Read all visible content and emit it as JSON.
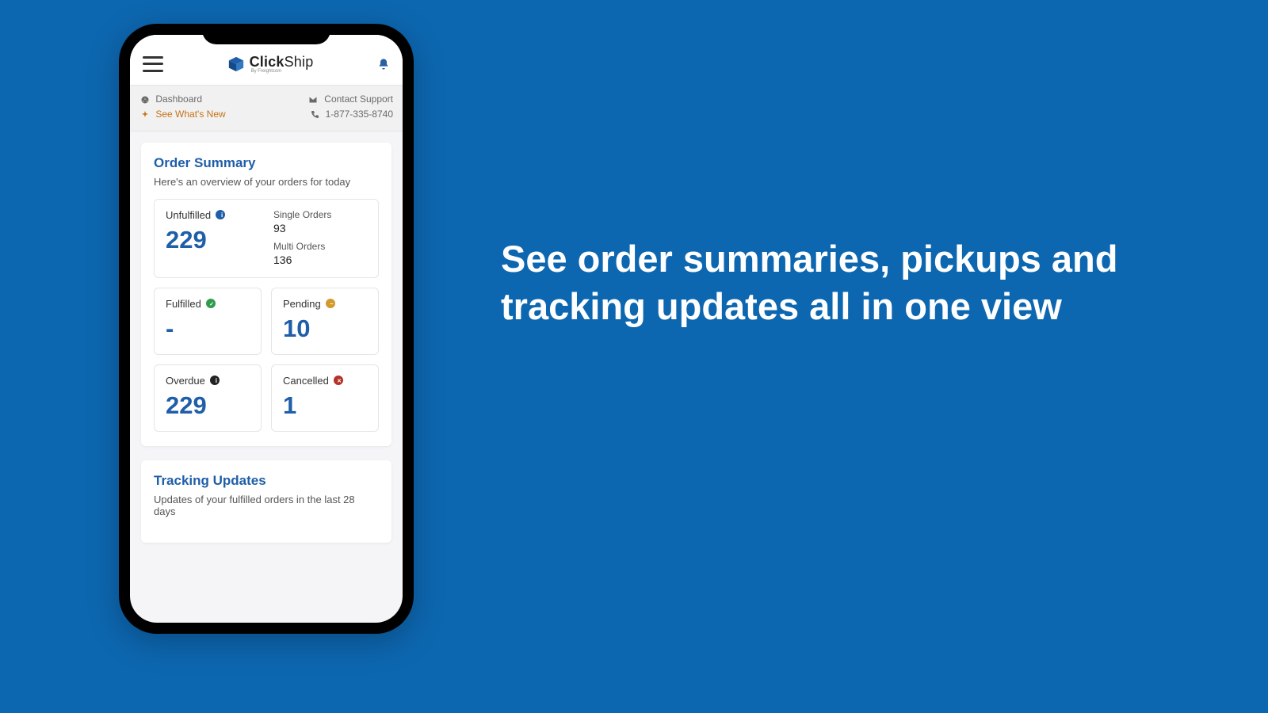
{
  "hero": {
    "headline": "See order summaries, pickups and tracking updates all in one view"
  },
  "app": {
    "brand_primary": "Click",
    "brand_secondary": "Ship",
    "brand_byline": "By Freightcom"
  },
  "subbar": {
    "dashboard_label": "Dashboard",
    "contact_label": "Contact Support",
    "whatsnew_label": "See What's New",
    "phone": "1-877-335-8740"
  },
  "order_summary": {
    "title": "Order Summary",
    "subtitle": "Here's an overview of your orders for today",
    "unfulfilled": {
      "label": "Unfulfilled",
      "value": "229"
    },
    "single_orders": {
      "label": "Single Orders",
      "value": "93"
    },
    "multi_orders": {
      "label": "Multi Orders",
      "value": "136"
    },
    "fulfilled": {
      "label": "Fulfilled",
      "value": "-"
    },
    "pending": {
      "label": "Pending",
      "value": "10"
    },
    "overdue": {
      "label": "Overdue",
      "value": "229"
    },
    "cancelled": {
      "label": "Cancelled",
      "value": "1"
    }
  },
  "tracking": {
    "title": "Tracking Updates",
    "subtitle": "Updates of your fulfilled orders in the last 28 days"
  },
  "colors": {
    "accent": "#1f5ea8",
    "bg": "#0d67b0",
    "link_warm": "#c77316",
    "ok": "#2e9c4b",
    "warn": "#d09a2d",
    "err": "#b33229"
  }
}
